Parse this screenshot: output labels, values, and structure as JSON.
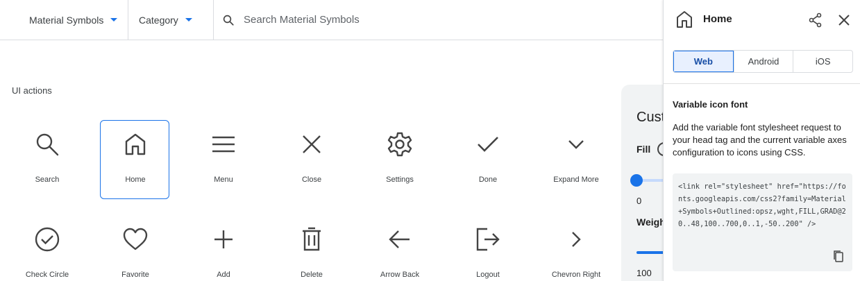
{
  "toolbar": {
    "set_dropdown": "Material Symbols",
    "category_dropdown": "Category",
    "search_placeholder": "Search Material Symbols",
    "accent_color": "#1a73e8"
  },
  "section": {
    "title": "UI actions"
  },
  "icons": [
    {
      "label": "Search",
      "icon": "search-icon"
    },
    {
      "label": "Home",
      "icon": "home-icon",
      "selected": true
    },
    {
      "label": "Menu",
      "icon": "menu-icon"
    },
    {
      "label": "Close",
      "icon": "close-icon"
    },
    {
      "label": "Settings",
      "icon": "settings-icon"
    },
    {
      "label": "Done",
      "icon": "done-icon"
    },
    {
      "label": "Expand More",
      "icon": "expand-more-icon"
    },
    {
      "label": "Check Circle",
      "icon": "check-circle-icon"
    },
    {
      "label": "Favorite",
      "icon": "favorite-icon"
    },
    {
      "label": "Add",
      "icon": "add-icon"
    },
    {
      "label": "Delete",
      "icon": "delete-icon"
    },
    {
      "label": "Arrow Back",
      "icon": "arrow-back-icon"
    },
    {
      "label": "Logout",
      "icon": "logout-icon"
    },
    {
      "label": "Chevron Right",
      "icon": "chevron-right-icon"
    }
  ],
  "customize": {
    "title": "Customize",
    "fill_label": "Fill",
    "fill_value": "0",
    "weight_label": "Weight",
    "weight_value": "100"
  },
  "side_panel": {
    "icon_name": "Home",
    "tabs": [
      "Web",
      "Android",
      "iOS"
    ],
    "active_tab": "Web",
    "section_title": "Variable icon font",
    "description": "Add the variable font stylesheet request to your head tag and the current variable axes configuration to icons using CSS.",
    "code": "<link rel=\"stylesheet\" href=\"https://fonts.googleapis.com/css2?family=Material+Symbols+Outlined:opsz,wght,FILL,GRAD@20..48,100..700,0..1,-50..200\" />"
  }
}
